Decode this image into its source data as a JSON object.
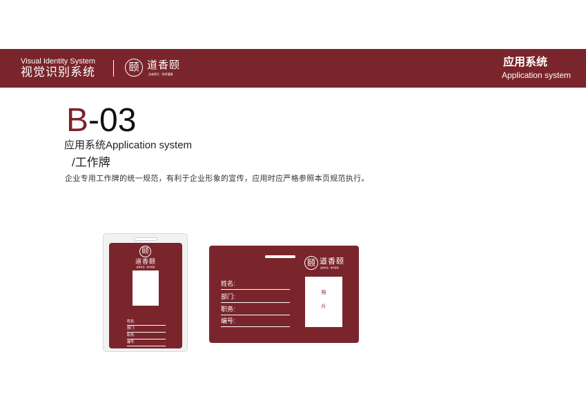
{
  "header": {
    "system_en": "Visual Identity System",
    "system_cn": "视觉识别系统",
    "logo_glyph": "颐",
    "brand_name": "道香颐",
    "brand_slogan": "品味养生 · 悦享健康",
    "section_cn": "应用系统",
    "section_en": "Application system",
    "band_color": "#7a252b"
  },
  "page": {
    "code_lead": "B",
    "code_rest": "-03",
    "title": "应用系统Application system",
    "subtitle": "/工作牌",
    "description": "企业专用工作牌的统一规范，有利于企业形象的宣传，应用时应严格参照本页规范执行。"
  },
  "vertical_badge": {
    "logo_glyph": "颐",
    "brand_name": "道香颐",
    "brand_slogan": "品味养生 · 悦享健康",
    "fields": [
      "姓名:",
      "部门:",
      "职务:",
      "编号:"
    ]
  },
  "horizontal_badge": {
    "logo_glyph": "颐",
    "brand_name": "道香颐",
    "brand_slogan": "品味养生 · 悦享健康",
    "fields": [
      "姓名:",
      "部门:",
      "职务:",
      "编号:"
    ],
    "photo_label_1": "照",
    "photo_label_2": "片"
  }
}
